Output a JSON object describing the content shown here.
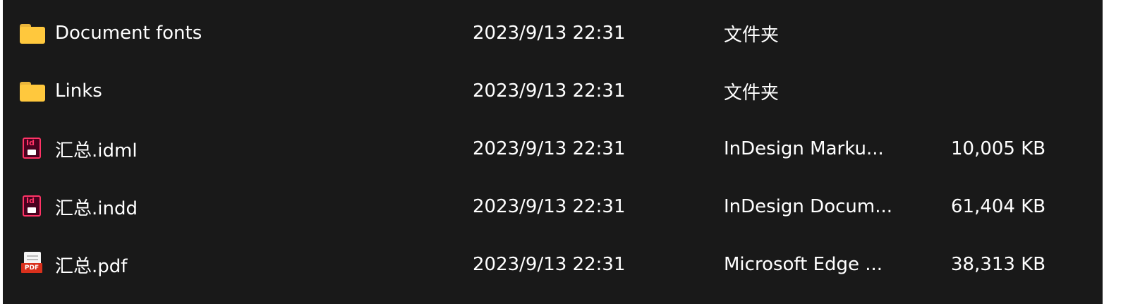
{
  "files": [
    {
      "icon": "folder-icon",
      "name": "Document fonts",
      "date": "2023/9/13 22:31",
      "type": "文件夹",
      "size": ""
    },
    {
      "icon": "folder-icon",
      "name": "Links",
      "date": "2023/9/13 22:31",
      "type": "文件夹",
      "size": ""
    },
    {
      "icon": "indesign-idml-icon",
      "icon_label": "Id",
      "name": "汇总.idml",
      "date": "2023/9/13 22:31",
      "type": "InDesign Marku...",
      "size": "10,005 KB"
    },
    {
      "icon": "indesign-indd-icon",
      "icon_label": "Id",
      "name": "汇总.indd",
      "date": "2023/9/13 22:31",
      "type": "InDesign Docum...",
      "size": "61,404 KB"
    },
    {
      "icon": "pdf-icon",
      "icon_label": "PDF",
      "name": "汇总.pdf",
      "date": "2023/9/13 22:31",
      "type": "Microsoft Edge ...",
      "size": "38,313 KB"
    }
  ],
  "colors": {
    "background": "#191919",
    "text": "#ffffff",
    "folder": "#ffc83d",
    "indesign": "#ff3366",
    "pdf": "#d9301c"
  }
}
